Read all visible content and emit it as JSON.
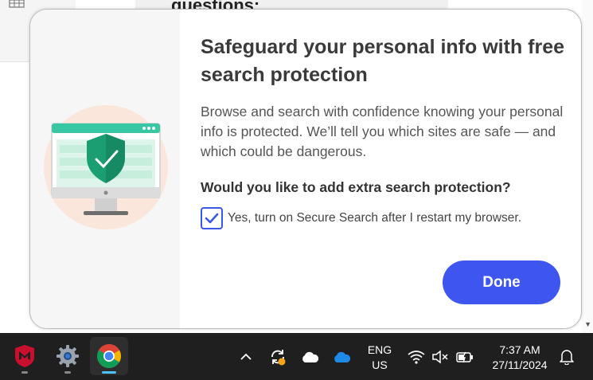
{
  "background": {
    "doc_heading_fragment": "questions:"
  },
  "dialog": {
    "title": "Safeguard your personal info with free search protection",
    "description": "Browse and search with confidence knowing your personal info is protected. We’ll tell you which sites are safe — and which could be dangerous.",
    "question": "Would you like to add extra search protection?",
    "checkbox_label": "Yes, turn on Secure Search after I restart my browser.",
    "checkbox_checked": true,
    "done_label": "Done",
    "accent_color": "#3e56ef",
    "illustration_icon": "shield-check-monitor-icon"
  },
  "taskbar": {
    "apps": [
      {
        "name": "mcafee-icon",
        "active": false
      },
      {
        "name": "settings-gear-icon",
        "active": false
      },
      {
        "name": "chrome-icon",
        "active": true
      }
    ],
    "tray_icons": [
      "chevron-up-icon",
      "sync-icon",
      "cloud-icon",
      "onedrive-icon",
      "wifi-icon",
      "speaker-muted-icon",
      "battery-charging-icon",
      "notification-bell-icon"
    ],
    "language_line1": "ENG",
    "language_line2": "US",
    "time": "7:37 AM",
    "date": "27/11/2024"
  }
}
